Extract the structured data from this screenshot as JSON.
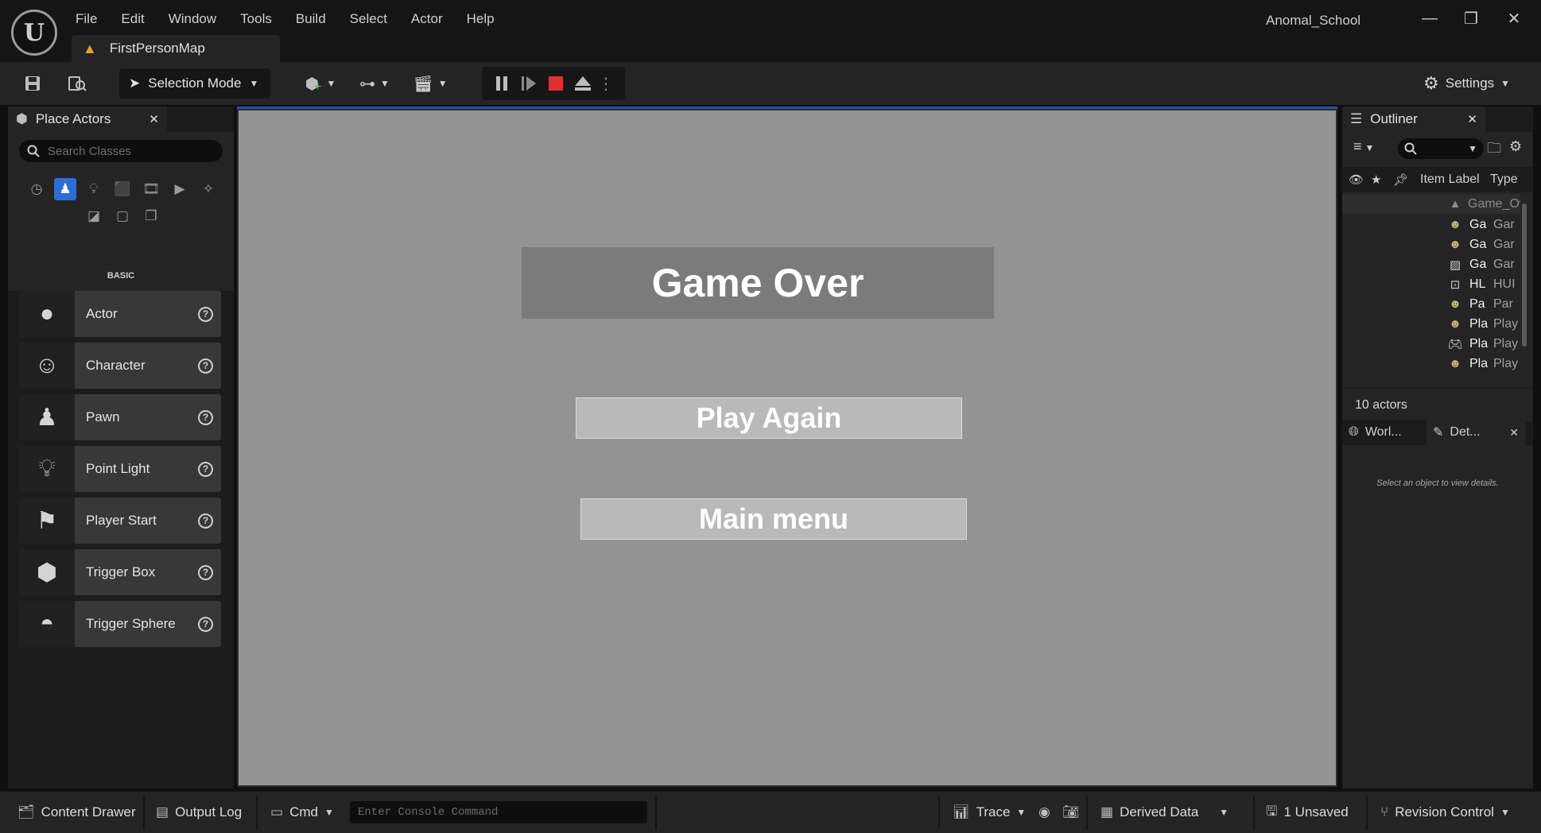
{
  "app": {
    "logo_text": "U",
    "project_name": "Anomal_School"
  },
  "menu": [
    "File",
    "Edit",
    "Window",
    "Tools",
    "Build",
    "Select",
    "Actor",
    "Help"
  ],
  "window_controls": {
    "minimize": "—",
    "restore": "❐",
    "close": "✕"
  },
  "document_tab": {
    "label": "FirstPersonMap"
  },
  "toolbar": {
    "selection_mode": "Selection Mode",
    "settings": "Settings"
  },
  "place_actors": {
    "tab_label": "Place Actors",
    "search_placeholder": "Search Classes",
    "category_label": "BASIC",
    "items": [
      {
        "label": "Actor",
        "icon": "sphere-icon"
      },
      {
        "label": "Character",
        "icon": "character-icon"
      },
      {
        "label": "Pawn",
        "icon": "pawn-icon"
      },
      {
        "label": "Point Light",
        "icon": "light-bulb-icon"
      },
      {
        "label": "Player Start",
        "icon": "player-start-icon"
      },
      {
        "label": "Trigger Box",
        "icon": "trigger-box-icon"
      },
      {
        "label": "Trigger Sphere",
        "icon": "trigger-sphere-icon"
      }
    ]
  },
  "viewport": {
    "title": "Game Over",
    "play_again": "Play Again",
    "main_menu": "Main menu"
  },
  "outliner": {
    "tab_label": "Outliner",
    "col_label": "Item Label",
    "col_type": "Type",
    "root": "Game_Ov",
    "rows": [
      {
        "label": "Ga",
        "type": "Gar"
      },
      {
        "label": "Ga",
        "type": "Gar"
      },
      {
        "label": "Ga",
        "type": "Gar"
      },
      {
        "label": "HL",
        "type": "HUI"
      },
      {
        "label": "Pa",
        "type": "Par"
      },
      {
        "label": "Pla",
        "type": "Play"
      },
      {
        "label": "Pla",
        "type": "Play"
      },
      {
        "label": "Pla",
        "type": "Play"
      }
    ],
    "count": "10 actors"
  },
  "details": {
    "world_tab": "Worl...",
    "details_tab": "Det...",
    "empty_message": "Select an object to view details."
  },
  "statusbar": {
    "content_drawer": "Content Drawer",
    "output_log": "Output Log",
    "cmd": "Cmd",
    "console_placeholder": "Enter Console Command",
    "trace": "Trace",
    "derived_data": "Derived Data",
    "unsaved": "1 Unsaved",
    "revision_control": "Revision Control"
  },
  "colors": {
    "accent": "#2c6ed8",
    "viewport_bg": "#939393",
    "stop_red": "#e03030",
    "panel_bg": "#242424"
  }
}
